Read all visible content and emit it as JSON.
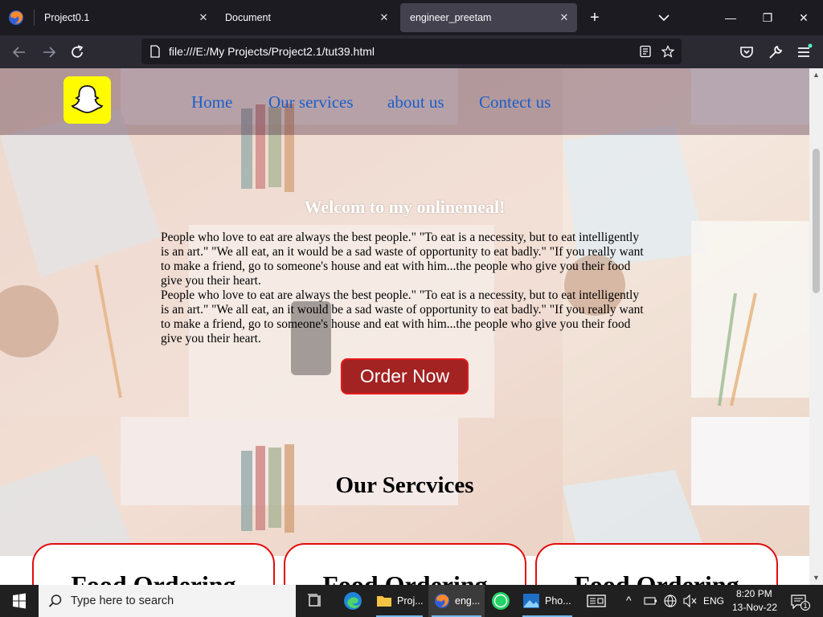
{
  "browser": {
    "tabs": [
      {
        "label": "Project0.1",
        "active": false
      },
      {
        "label": "Document",
        "active": false
      },
      {
        "label": "engineer_preetam",
        "active": true
      }
    ],
    "new_tab": "+",
    "url": "file:///E:/My Projects/Project2.1/tut39.html",
    "window_controls": {
      "minimize": "—",
      "restore": "❐",
      "close": "✕"
    }
  },
  "page": {
    "nav": [
      "Home",
      "Our services",
      "about us",
      "Contect us"
    ],
    "hero_title": "Welcom to my onlinemeal!",
    "hero_text": "People who love to eat are always the best people.\" \"To eat is a necessity, but to eat intelligently is an art.\" \"We all eat, an it would be a sad waste of opportunity to eat badly.\" \"If you really want to make a friend, go to someone's house and eat with him...the people who give you their food give you their heart.\nPeople who love to eat are always the best people.\" \"To eat is a necessity, but to eat intelligently is an art.\" \"We all eat, an it would be a sad waste of opportunity to eat badly.\" \"If you really want to make a friend, go to someone's house and eat with him...the people who give you their food give you their heart.",
    "order_button": "Order Now",
    "services_title": "Our Sercvices",
    "service_cards": [
      "Food Ordering",
      "Food Ordering",
      "Food Ordering"
    ]
  },
  "taskbar": {
    "search_placeholder": "Type here to search",
    "apps": [
      {
        "name": "task-view-icon",
        "label": ""
      },
      {
        "name": "edge-icon",
        "label": ""
      },
      {
        "name": "file-explorer-icon",
        "label": "Proj..."
      },
      {
        "name": "firefox-icon",
        "label": "eng..."
      },
      {
        "name": "whatsapp-icon",
        "label": ""
      },
      {
        "name": "photos-icon",
        "label": "Pho..."
      }
    ],
    "language": "ENG",
    "time": "8:20 PM",
    "date": "13-Nov-22",
    "notification_count": "1"
  },
  "colors": {
    "nav_link": "#1a5fc9",
    "order_button_bg": "#a32222",
    "card_border": "#e20d0d",
    "snap_yellow": "#fffc00"
  }
}
